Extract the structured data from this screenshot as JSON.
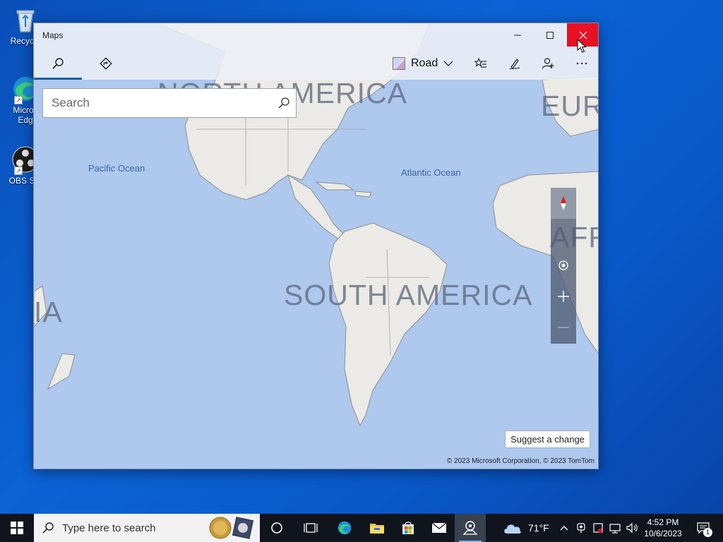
{
  "desktop": {
    "icons": [
      {
        "label": "Recycle"
      },
      {
        "label": "Micros Edg"
      },
      {
        "label": "OBS Stu"
      }
    ]
  },
  "window": {
    "title": "Maps",
    "controls": {
      "minimize": "minimize-icon",
      "maximize": "maximize-icon",
      "close": "close-icon"
    }
  },
  "appbar": {
    "tabs": [
      {
        "icon": "search-icon",
        "selected": true
      },
      {
        "icon": "directions-icon",
        "selected": false
      }
    ],
    "map_style": "Road",
    "tools": [
      "favorites-icon",
      "ink-pen-icon",
      "user-icon",
      "more-icon"
    ],
    "accent_color": "#0063b1"
  },
  "search": {
    "placeholder": "Search",
    "value": ""
  },
  "map": {
    "continent_labels": {
      "north_america": "NORTH AMERICA",
      "south_america": "SOUTH AMERICA",
      "europe": "EUR",
      "africa": "AFR",
      "asia": "IA"
    },
    "ocean_labels": {
      "pacific": "Pacific Ocean",
      "atlantic": "Atlantic Ocean"
    },
    "controls": [
      "compass-icon",
      "locate-me-icon",
      "zoom-in-icon",
      "zoom-out-icon"
    ],
    "suggest_label": "Suggest a change",
    "copyright": "© 2023 Microsoft Corporation, © 2023 TomTom"
  },
  "taskbar": {
    "search_placeholder": "Type here to search",
    "pinned": [
      "task-view-icon",
      "timeline-icon",
      "edge-icon",
      "file-explorer-icon",
      "store-icon",
      "mail-icon",
      "maps-icon"
    ],
    "active": "maps-icon",
    "weather": {
      "temp": "71°F",
      "icon": "cloud-icon"
    },
    "clock": {
      "time": "4:52 PM",
      "date": "10/6/2023"
    },
    "notification_count": "1",
    "close_button_color": "#e81123"
  }
}
